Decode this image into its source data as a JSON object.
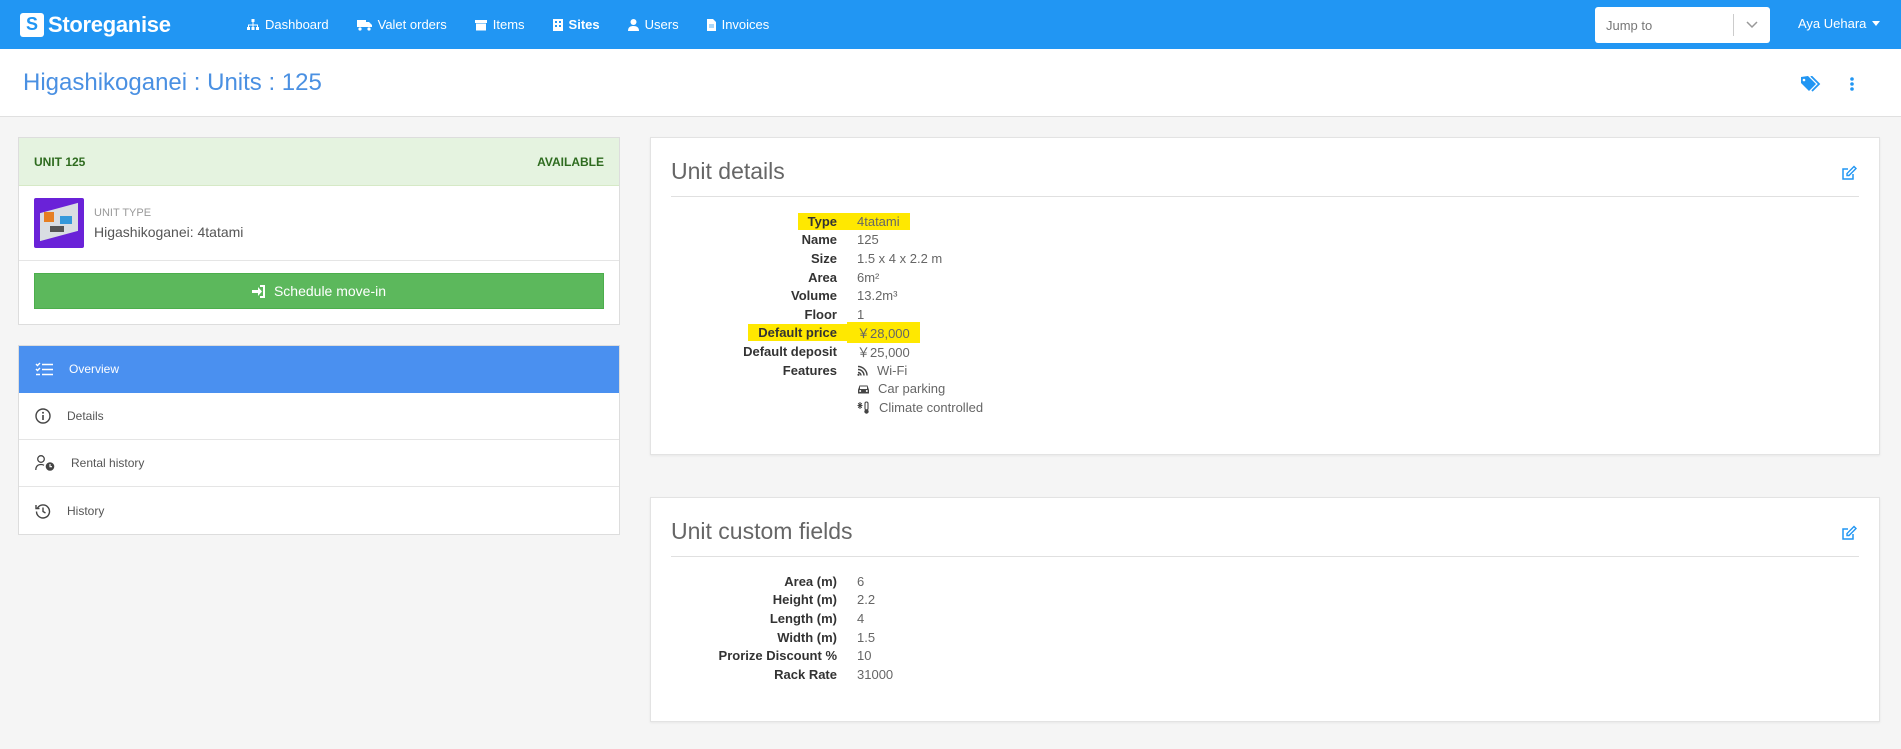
{
  "brand": {
    "name": "Storeganise"
  },
  "nav": {
    "items": [
      {
        "label": "Dashboard",
        "icon": "sitemap-icon"
      },
      {
        "label": "Valet orders",
        "icon": "truck-icon"
      },
      {
        "label": "Items",
        "icon": "archive-icon"
      },
      {
        "label": "Sites",
        "icon": "building-icon",
        "active": true
      },
      {
        "label": "Users",
        "icon": "user-icon"
      },
      {
        "label": "Invoices",
        "icon": "file-icon"
      }
    ],
    "jump_to_placeholder": "Jump to",
    "user_name": "Aya Uehara"
  },
  "page": {
    "title": "Higashikoganei : Units : 125"
  },
  "unit_card": {
    "unit_label": "UNIT 125",
    "status": "AVAILABLE",
    "unit_type_label": "UNIT TYPE",
    "unit_type_value": "Higashikoganei: 4tatami",
    "schedule_button": "Schedule move-in"
  },
  "side_nav": {
    "items": [
      {
        "label": "Overview",
        "icon": "checklist-icon",
        "active": true
      },
      {
        "label": "Details",
        "icon": "info-icon"
      },
      {
        "label": "Rental history",
        "icon": "user-clock-icon"
      },
      {
        "label": "History",
        "icon": "history-icon"
      }
    ]
  },
  "unit_details": {
    "title": "Unit details",
    "rows": [
      {
        "label": "Type",
        "value": "4tatami",
        "highlight": true
      },
      {
        "label": "Name",
        "value": "125"
      },
      {
        "label": "Size",
        "value": "1.5 x 4 x 2.2 m"
      },
      {
        "label": "Area",
        "value": "6m²"
      },
      {
        "label": "Volume",
        "value": "13.2m³"
      },
      {
        "label": "Floor",
        "value": "1"
      },
      {
        "label": "Default price",
        "value": "￥28,000",
        "highlight": true
      },
      {
        "label": "Default deposit",
        "value": "￥25,000"
      }
    ],
    "features_label": "Features",
    "features": [
      {
        "label": "Wi-Fi",
        "icon": "wifi-icon"
      },
      {
        "label": "Car parking",
        "icon": "car-icon"
      },
      {
        "label": "Climate controlled",
        "icon": "thermometer-icon"
      }
    ]
  },
  "custom_fields": {
    "title": "Unit custom fields",
    "rows": [
      {
        "label": "Area (m)",
        "value": "6"
      },
      {
        "label": "Height (m)",
        "value": "2.2"
      },
      {
        "label": "Length (m)",
        "value": "4"
      },
      {
        "label": "Width (m)",
        "value": "1.5"
      },
      {
        "label": "Prorize Discount %",
        "value": "10"
      },
      {
        "label": "Rack Rate",
        "value": "31000"
      }
    ]
  },
  "colors": {
    "navbar": "#2196f3",
    "title": "#4a90e2",
    "available_bg": "#e5f3e0",
    "success": "#5cb85c",
    "active_nav": "#4a90f0",
    "highlight": "#ffe800"
  }
}
